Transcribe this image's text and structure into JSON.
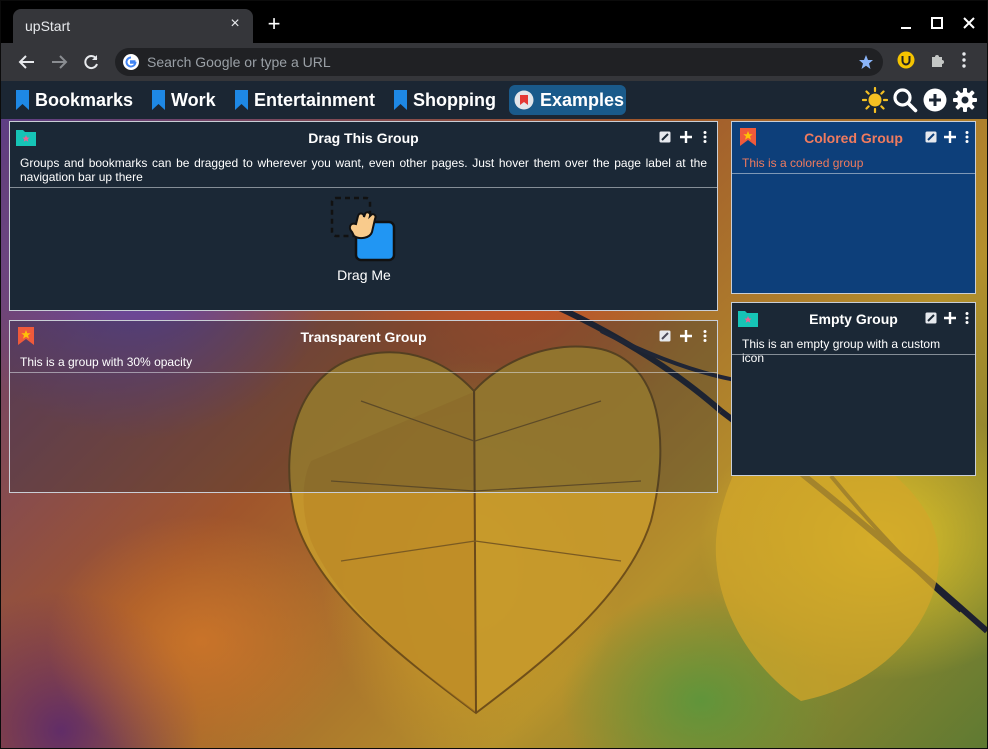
{
  "browser": {
    "tab_title": "upStart",
    "tab_close_icon": "×",
    "new_tab_icon": "+",
    "omnibox_placeholder": "Search Google or type a URL"
  },
  "navbar": {
    "pages": [
      {
        "label": "Bookmarks",
        "active": false
      },
      {
        "label": "Work",
        "active": false
      },
      {
        "label": "Entertainment",
        "active": false
      },
      {
        "label": "Shopping",
        "active": false
      },
      {
        "label": "Examples",
        "active": true
      }
    ],
    "icons": [
      "sun-icon",
      "search-icon",
      "add-circle-icon",
      "gear-icon"
    ]
  },
  "groups": {
    "drag": {
      "title": "Drag This Group",
      "description": "Groups and bookmarks can be dragged to wherever you want, even other pages. Just hover them over the page label at the navigation bar up there",
      "bookmark_label": "Drag Me"
    },
    "transparent": {
      "title": "Transparent Group",
      "description": "This is a group with 30% opacity"
    },
    "colored": {
      "title": "Colored Group",
      "description": "This is a colored group"
    },
    "empty": {
      "title": "Empty Group",
      "description": "This is an empty group with a custom icon"
    }
  },
  "colors": {
    "navbar_bg": "#1b2633",
    "group_bg": "#1b2836",
    "colored_group_bg": "#0d3f7a",
    "colored_group_text": "#f07b5e",
    "active_page_bg": "#1a5a8a",
    "bookmark_icon": "#1e88e5"
  }
}
